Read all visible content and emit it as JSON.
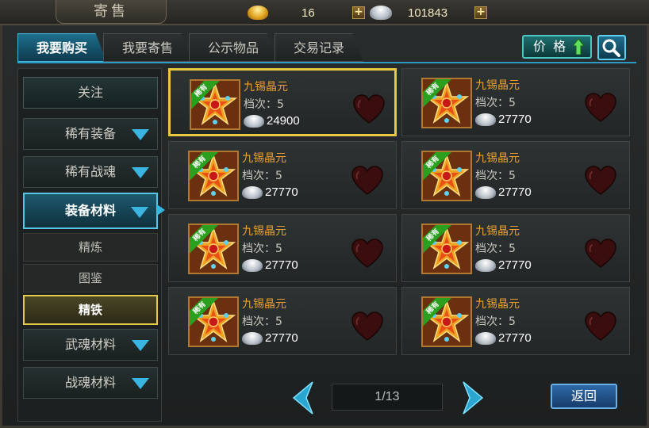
{
  "window": {
    "title": "寄售"
  },
  "currency": {
    "gold": "16",
    "silver": "101843",
    "plus": "+"
  },
  "tabs": [
    {
      "label": "我要购买",
      "active": true
    },
    {
      "label": "我要寄售",
      "active": false
    },
    {
      "label": "公示物品",
      "active": false
    },
    {
      "label": "交易记录",
      "active": false
    }
  ],
  "toolbar": {
    "sort_label": "价 格",
    "sort_icon": "up-arrow-icon",
    "search_icon": "search-icon"
  },
  "sidebar": {
    "items": [
      {
        "label": "关注"
      },
      {
        "label": "稀有装备"
      },
      {
        "label": "稀有战魂"
      },
      {
        "label": "装备材料"
      },
      {
        "label": "精炼"
      },
      {
        "label": "图鉴"
      },
      {
        "label": "精铁"
      },
      {
        "label": "武魂材料"
      },
      {
        "label": "战魂材料"
      }
    ]
  },
  "listings": [
    {
      "name": "九锡晶元",
      "grade": "档次：5",
      "price": "24900",
      "tag": "稀有"
    },
    {
      "name": "九锡晶元",
      "grade": "档次：5",
      "price": "27770",
      "tag": "稀有"
    },
    {
      "name": "九锡晶元",
      "grade": "档次：5",
      "price": "27770",
      "tag": "稀有"
    },
    {
      "name": "九锡晶元",
      "grade": "档次：5",
      "price": "27770",
      "tag": "稀有"
    },
    {
      "name": "九锡晶元",
      "grade": "档次：5",
      "price": "27770",
      "tag": "稀有"
    },
    {
      "name": "九锡晶元",
      "grade": "档次：5",
      "price": "27770",
      "tag": "稀有"
    },
    {
      "name": "九锡晶元",
      "grade": "档次：5",
      "price": "27770",
      "tag": "稀有"
    },
    {
      "name": "九锡晶元",
      "grade": "档次：5",
      "price": "27770",
      "tag": "稀有"
    }
  ],
  "pager": {
    "page": "1/13"
  },
  "footer": {
    "back_label": "返回"
  },
  "colors": {
    "accent": "#2d9ac4",
    "selected": "#e8c840",
    "item_name": "#e8a030",
    "rare_tag": "#2aa01e"
  }
}
